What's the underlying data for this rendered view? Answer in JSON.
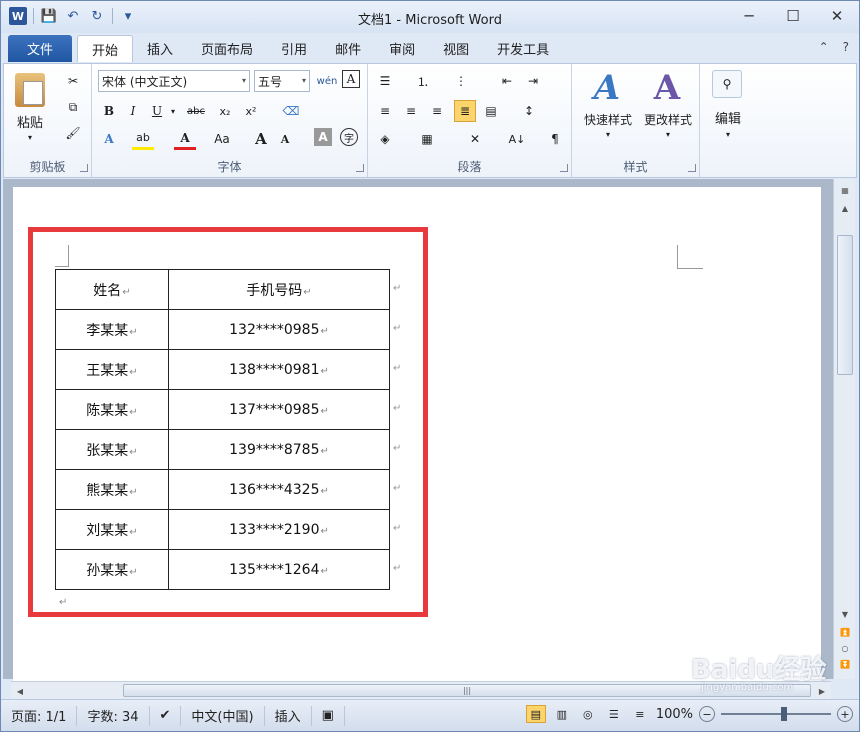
{
  "window": {
    "title": "文档1 - Microsoft Word",
    "minimize": "─",
    "maximize": "☐",
    "close": "✕",
    "help": "?"
  },
  "qat": {
    "logo": "W",
    "save": "💾",
    "undo": "↶",
    "redo": "↻",
    "customize": "▾"
  },
  "tabs": {
    "file": "文件",
    "items": [
      "开始",
      "插入",
      "页面布局",
      "引用",
      "邮件",
      "审阅",
      "视图",
      "开发工具"
    ],
    "collapse": "⌃"
  },
  "ribbon": {
    "clipboard": {
      "paste": "粘贴",
      "label": "剪贴板"
    },
    "font": {
      "name": "宋体 (中文正文)",
      "size": "五号",
      "wen": "wén",
      "char_border": "A",
      "bold": "B",
      "italic": "I",
      "underline": "U",
      "strike": "abc",
      "sub": "x₂",
      "sup": "x²",
      "grow": "A",
      "shrink": "A",
      "case": "Aa",
      "label": "字体"
    },
    "paragraph": {
      "label": "段落"
    },
    "styles": {
      "quick": "快速样式",
      "change": "更改样式",
      "label": "样式",
      "glyph": "A"
    },
    "editing": {
      "label": "编辑"
    }
  },
  "table": {
    "headers": [
      "姓名",
      "手机号码"
    ],
    "rows": [
      [
        "李某某",
        "132****0985"
      ],
      [
        "王某某",
        "138****0981"
      ],
      [
        "陈某某",
        "137****0985"
      ],
      [
        "张某某",
        "139****8785"
      ],
      [
        "熊某某",
        "136****4325"
      ],
      [
        "刘某某",
        "133****2190"
      ],
      [
        "孙某某",
        "135****1264"
      ]
    ]
  },
  "statusbar": {
    "page": "页面: 1/1",
    "words": "字数: 34",
    "language": "中文(中国)",
    "mode": "插入",
    "zoom": "100%",
    "zoom_out": "−",
    "zoom_in": "+"
  },
  "watermark": {
    "brand": "Baidu经验",
    "url": "jingyan.baidu.com"
  },
  "colors": {
    "highlight_border": "#e8393d",
    "file_tab": "#2b579a",
    "active_button": "#fbd56c"
  }
}
